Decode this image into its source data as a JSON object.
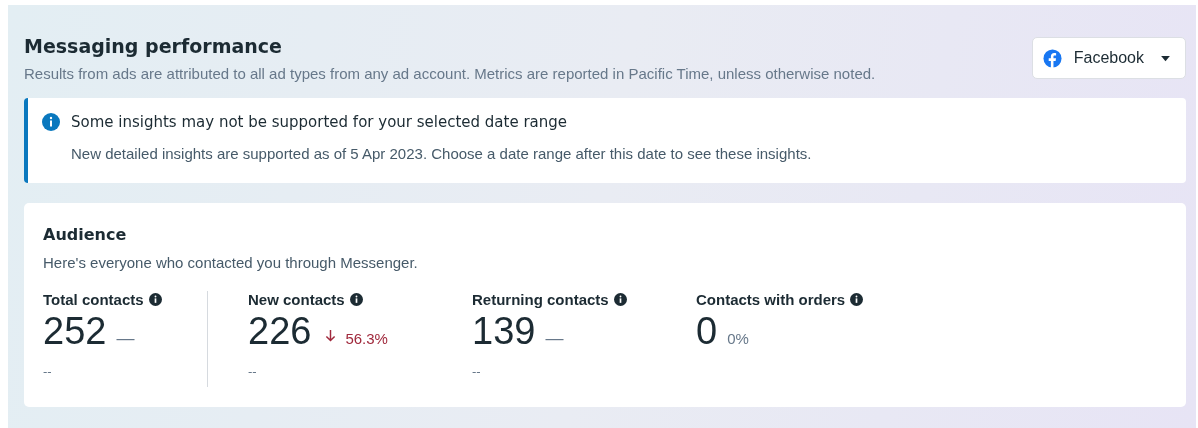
{
  "header": {
    "title": "Messaging performance",
    "subtitle": "Results from ads are attributed to all ad types from any ad account. Metrics are reported in Pacific Time, unless otherwise noted."
  },
  "platform_dropdown": {
    "label": "Facebook"
  },
  "notice": {
    "title": "Some insights may not be supported for your selected date range",
    "body": "New detailed insights are supported as of 5 Apr 2023. Choose a date range after this date to see these insights."
  },
  "audience": {
    "title": "Audience",
    "description": "Here's everyone who contacted you through Messenger.",
    "metrics": [
      {
        "label": "Total contacts",
        "value": "252",
        "change": "—",
        "kind": "none",
        "comparison": "--"
      },
      {
        "label": "New contacts",
        "value": "226",
        "change": "56.3%",
        "kind": "down",
        "comparison": "--"
      },
      {
        "label": "Returning contacts",
        "value": "139",
        "change": "—",
        "kind": "none",
        "comparison": "--"
      },
      {
        "label": "Contacts with orders",
        "value": "0",
        "change": "0%",
        "kind": "share"
      }
    ]
  }
}
